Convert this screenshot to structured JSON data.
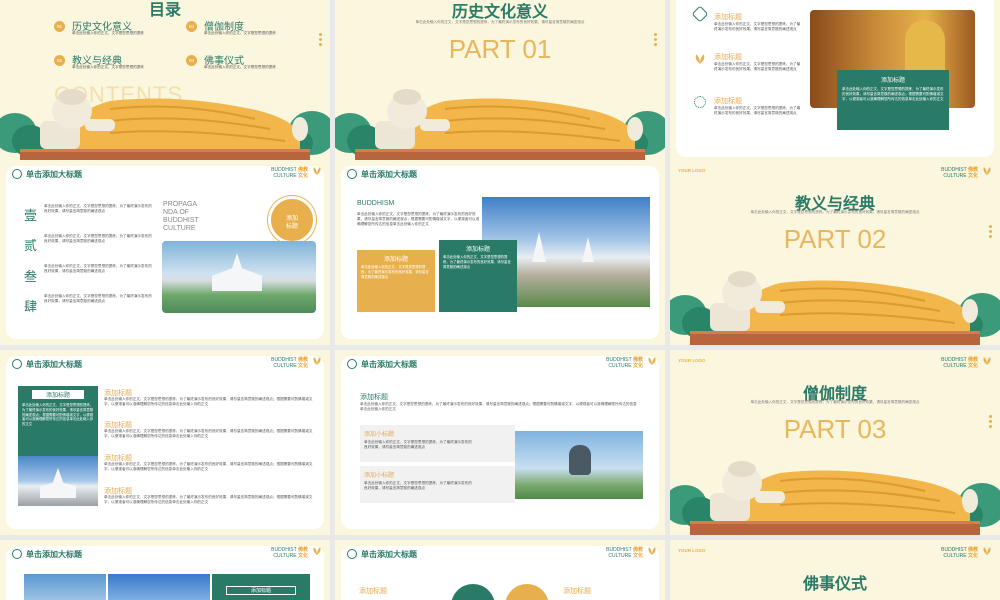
{
  "colors": {
    "teal": "#2a7a68",
    "gold": "#e8b04c",
    "cream": "#fbf6de"
  },
  "common": {
    "header_title": "单击添加大标题",
    "brand_en": "BUDDHIST",
    "brand_cn": "佛教",
    "brand_en2": "CULTURE",
    "brand_cn2": "文化",
    "logo": "YOUR LOGO",
    "add_title": "添加标题",
    "add_subtitle": "添加小标题",
    "lorem": "单击此处输入你的正文，文字是您思想的提炼，为了最终演示发布的良好效果，请尽量言简意赅的阐述观点；根据需要可酌情增减文字，以便观者可以准确理解您所传达的信息单击此处输入你的正文",
    "lorem_short": "单击此处输入你的正文，文字是您思想的提炼，为了最终演示发布的良好效果，请尽量言简意赅的阐述观点"
  },
  "slide1": {
    "title": "目录",
    "contents": "CONTENTS",
    "items": [
      {
        "num": "01",
        "label": "历史文化意义"
      },
      {
        "num": "02",
        "label": "教义与经典"
      },
      {
        "num": "03",
        "label": "僧伽制度"
      },
      {
        "num": "04",
        "label": "佛事仪式"
      }
    ],
    "item_desc": "单击此处输入你的正文，文字是您思想的提炼"
  },
  "slide2": {
    "title": "历史文化意义",
    "part": "PART 01"
  },
  "slide3": {
    "box_title": "添加标题"
  },
  "slide4": {
    "chars": [
      "壹",
      "贰",
      "叁",
      "肆"
    ],
    "propaganda": [
      "PROPAGA",
      "NDA OF",
      "BUDDHIST",
      "CULTURE"
    ],
    "circle": [
      "添加",
      "标题"
    ]
  },
  "slide5": {
    "label": "BUDDHISM"
  },
  "slide6": {
    "title": "教义与经典",
    "part": "PART 02"
  },
  "slide9": {
    "title": "僧伽制度",
    "part": "PART 03"
  },
  "slide12": {
    "title": "佛事仪式"
  }
}
